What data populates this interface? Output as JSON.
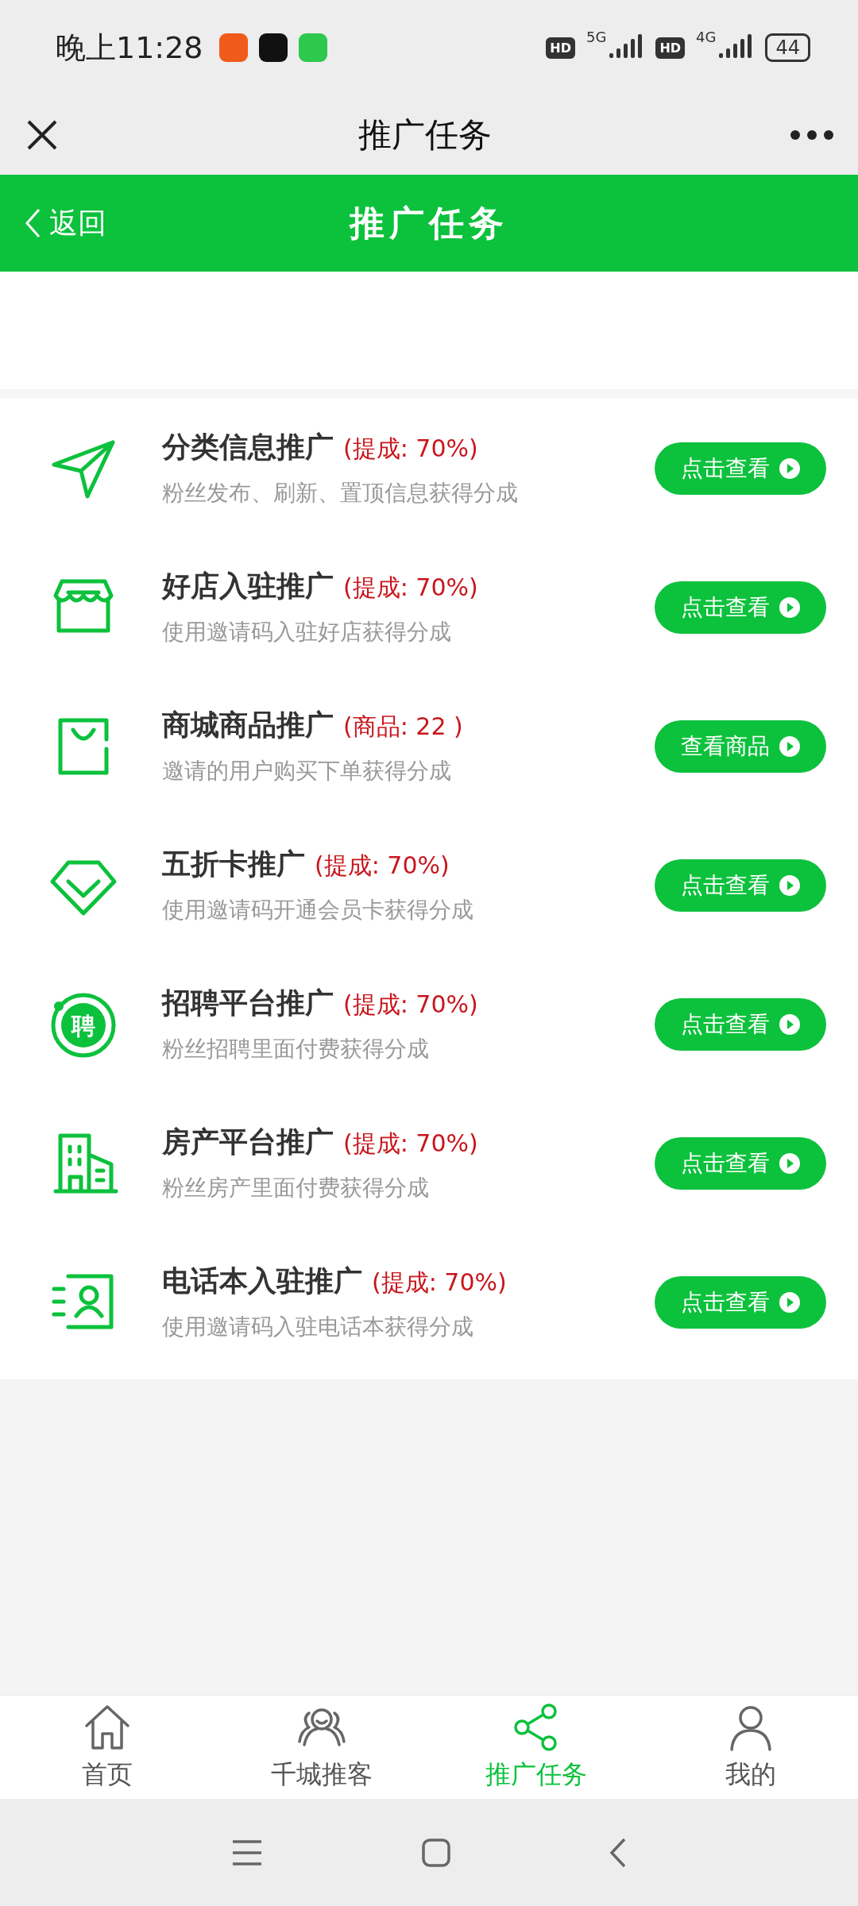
{
  "status_bar": {
    "time": "晚上11:28",
    "network": [
      {
        "badge": "HD",
        "generation": "5G"
      },
      {
        "badge": "HD",
        "generation": "4G"
      }
    ],
    "battery": "44"
  },
  "title_bar": {
    "title": "推广任务"
  },
  "header": {
    "back": "返回",
    "title": "推广任务"
  },
  "tasks": [
    {
      "title": "分类信息推广",
      "tag": "(提成: 70%)",
      "description": "粉丝发布、刷新、置顶信息获得分成",
      "button": "点击查看"
    },
    {
      "title": "好店入驻推广",
      "tag": "(提成: 70%)",
      "description": "使用邀请码入驻好店获得分成",
      "button": "点击查看"
    },
    {
      "title": "商城商品推广",
      "tag": "(商品: 22 )",
      "description": "邀请的用户购买下单获得分成",
      "button": "查看商品"
    },
    {
      "title": "五折卡推广",
      "tag": "(提成: 70%)",
      "description": "使用邀请码开通会员卡获得分成",
      "button": "点击查看"
    },
    {
      "icon_text": "聘",
      "title": "招聘平台推广",
      "tag": "(提成: 70%)",
      "description": "粉丝招聘里面付费获得分成",
      "button": "点击查看"
    },
    {
      "title": "房产平台推广",
      "tag": "(提成: 70%)",
      "description": "粉丝房产里面付费获得分成",
      "button": "点击查看"
    },
    {
      "title": "电话本入驻推广",
      "tag": "(提成: 70%)",
      "description": "使用邀请码入驻电话本获得分成",
      "button": "点击查看"
    }
  ],
  "tab_bar": [
    {
      "label": "首页",
      "selected": false
    },
    {
      "label": "千城推客",
      "selected": false
    },
    {
      "label": "推广任务",
      "selected": true
    },
    {
      "label": "我的",
      "selected": false
    }
  ]
}
